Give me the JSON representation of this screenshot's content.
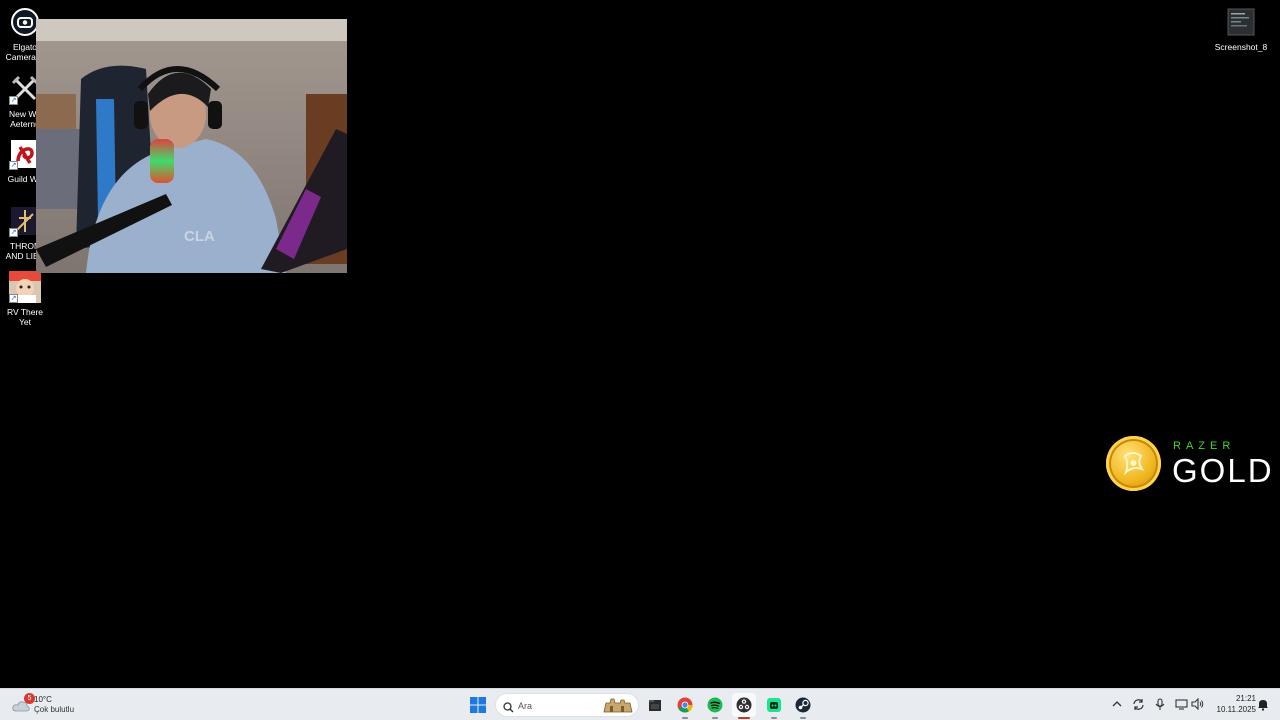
{
  "desktop": {
    "icons": [
      {
        "label": "Elgato\nCamera H"
      },
      {
        "label": "New Wo\nAeternu"
      },
      {
        "label": "Guild Wa"
      },
      {
        "label": "THRON\nAND LIBE"
      },
      {
        "label": "RV There Yet"
      }
    ],
    "file_icon": {
      "label": "Screenshot_8"
    },
    "razer": {
      "brand": "RAZER",
      "product": "GOLD"
    }
  },
  "taskbar": {
    "weather": {
      "temp": "10°C",
      "condition": "Çok bulutlu",
      "badge": "5"
    },
    "search": {
      "placeholder": "Ara"
    },
    "apps": [
      {
        "name": "start"
      },
      {
        "name": "file-explorer"
      },
      {
        "name": "chrome"
      },
      {
        "name": "spotify"
      },
      {
        "name": "obs"
      },
      {
        "name": "discord-like"
      },
      {
        "name": "steam"
      }
    ],
    "clock": {
      "time": "21:21",
      "date": "10.11.2025"
    }
  },
  "colors": {
    "razer_green": "#44d62c",
    "gold": "#f0b51c",
    "taskbar": "#e8ecf1"
  }
}
